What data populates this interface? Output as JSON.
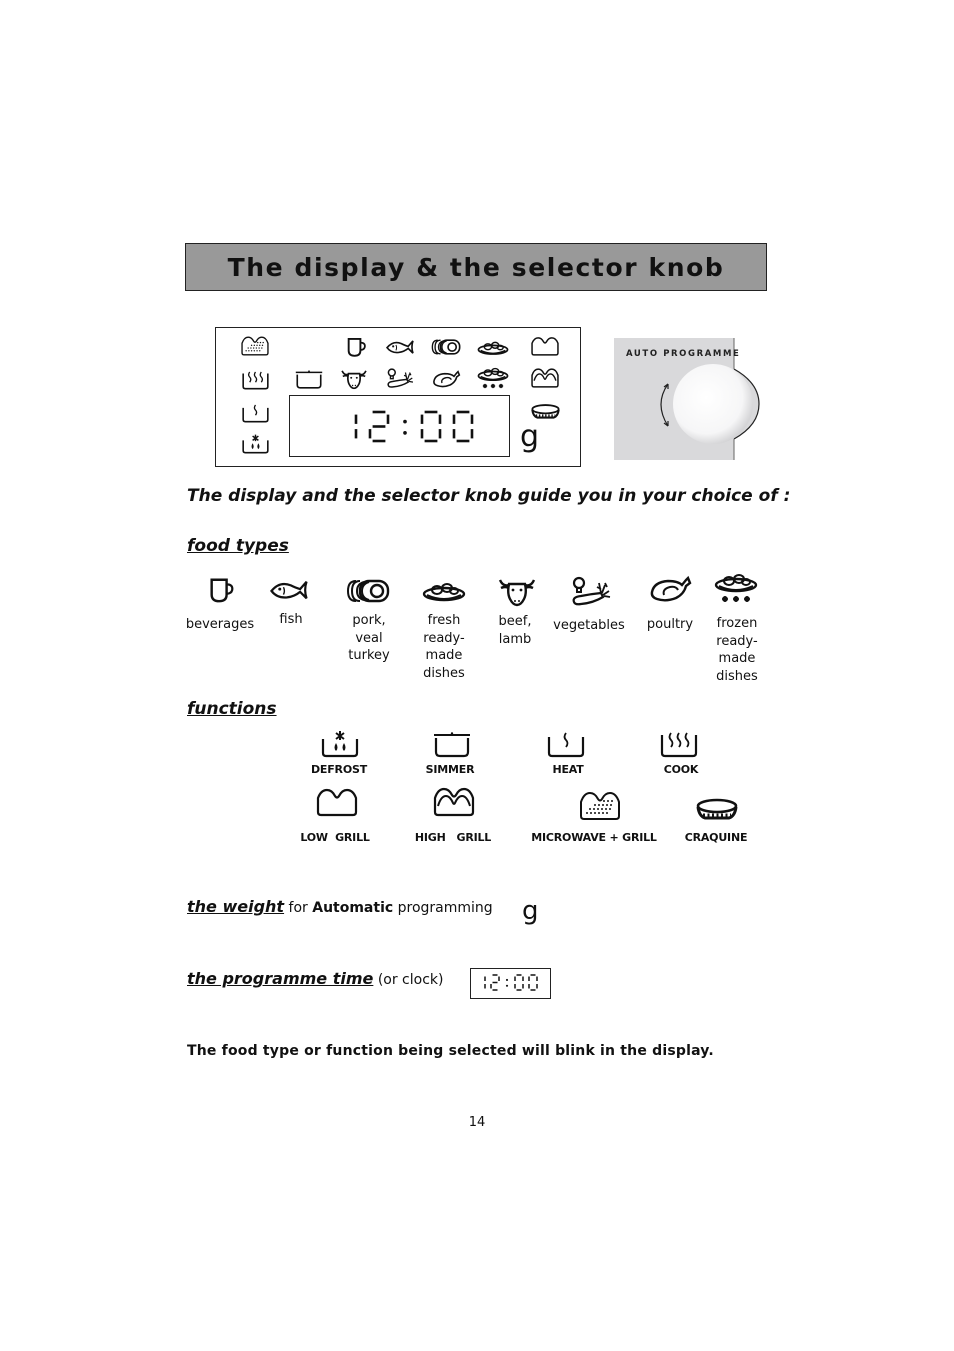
{
  "page": {
    "title": "The display & the selector knob",
    "page_number": "14"
  },
  "display": {
    "time": "12:00",
    "weight_unit": "g",
    "left_icons": [
      "microwave-grill-icon",
      "cook-icon",
      "heat-icon",
      "defrost-icon"
    ],
    "top_row_icons": [
      "beverages-icon",
      "fish-icon",
      "pork-veal-turkey-icon",
      "fresh-ready-made-dishes-icon",
      "low-grill-icon"
    ],
    "second_row_icons": [
      "simmer-icon",
      "beef-lamb-icon",
      "vegetables-icon",
      "poultry-icon",
      "frozen-ready-made-dishes-icon",
      "high-grill-icon"
    ],
    "right_icons": [
      "craquine-icon"
    ]
  },
  "knob": {
    "label": "AUTO PROGRAMME",
    "panel_color": "#d9d9db"
  },
  "intro": "The display and the selector knob guide you in your choice of :",
  "food_types": {
    "heading": "food types",
    "items": [
      {
        "icon": "beverages-icon",
        "label": [
          "beverages"
        ]
      },
      {
        "icon": "fish-icon",
        "label": [
          "fish"
        ]
      },
      {
        "icon": "pork-veal-turkey-icon",
        "label": [
          "pork,",
          "veal",
          "turkey"
        ]
      },
      {
        "icon": "fresh-ready-made-dishes-icon",
        "label": [
          "fresh",
          "ready-",
          "made",
          "dishes"
        ]
      },
      {
        "icon": "beef-lamb-icon",
        "label": [
          "beef,",
          "lamb"
        ]
      },
      {
        "icon": "vegetables-icon",
        "label": [
          "vegetables"
        ]
      },
      {
        "icon": "poultry-icon",
        "label": [
          "poultry"
        ]
      },
      {
        "icon": "frozen-ready-made-dishes-icon",
        "label": [
          "frozen",
          "ready-",
          "made",
          "dishes"
        ]
      }
    ]
  },
  "functions": {
    "heading": "functions",
    "items": [
      {
        "icon": "defrost-icon",
        "label": "DEFROST"
      },
      {
        "icon": "simmer-icon",
        "label": "SIMMER"
      },
      {
        "icon": "heat-icon",
        "label": "HEAT"
      },
      {
        "icon": "cook-icon",
        "label": "COOK"
      },
      {
        "icon": "low-grill-icon",
        "label": "LOW  GRILL"
      },
      {
        "icon": "high-grill-icon",
        "label": "HIGH   GRILL"
      },
      {
        "icon": "microwave-grill-icon",
        "label": "MICROWAVE + GRILL"
      },
      {
        "icon": "craquine-icon",
        "label": "CRAQUINE"
      }
    ]
  },
  "weight": {
    "heading": "the weight",
    "text_for": "for",
    "text_bold": "Automatic",
    "text_rest": "programming",
    "symbol": "g"
  },
  "programme_time": {
    "heading": "the programme time",
    "text": "(or clock)",
    "time": "12:00"
  },
  "note": "The food type or function being selected will blink in the display."
}
